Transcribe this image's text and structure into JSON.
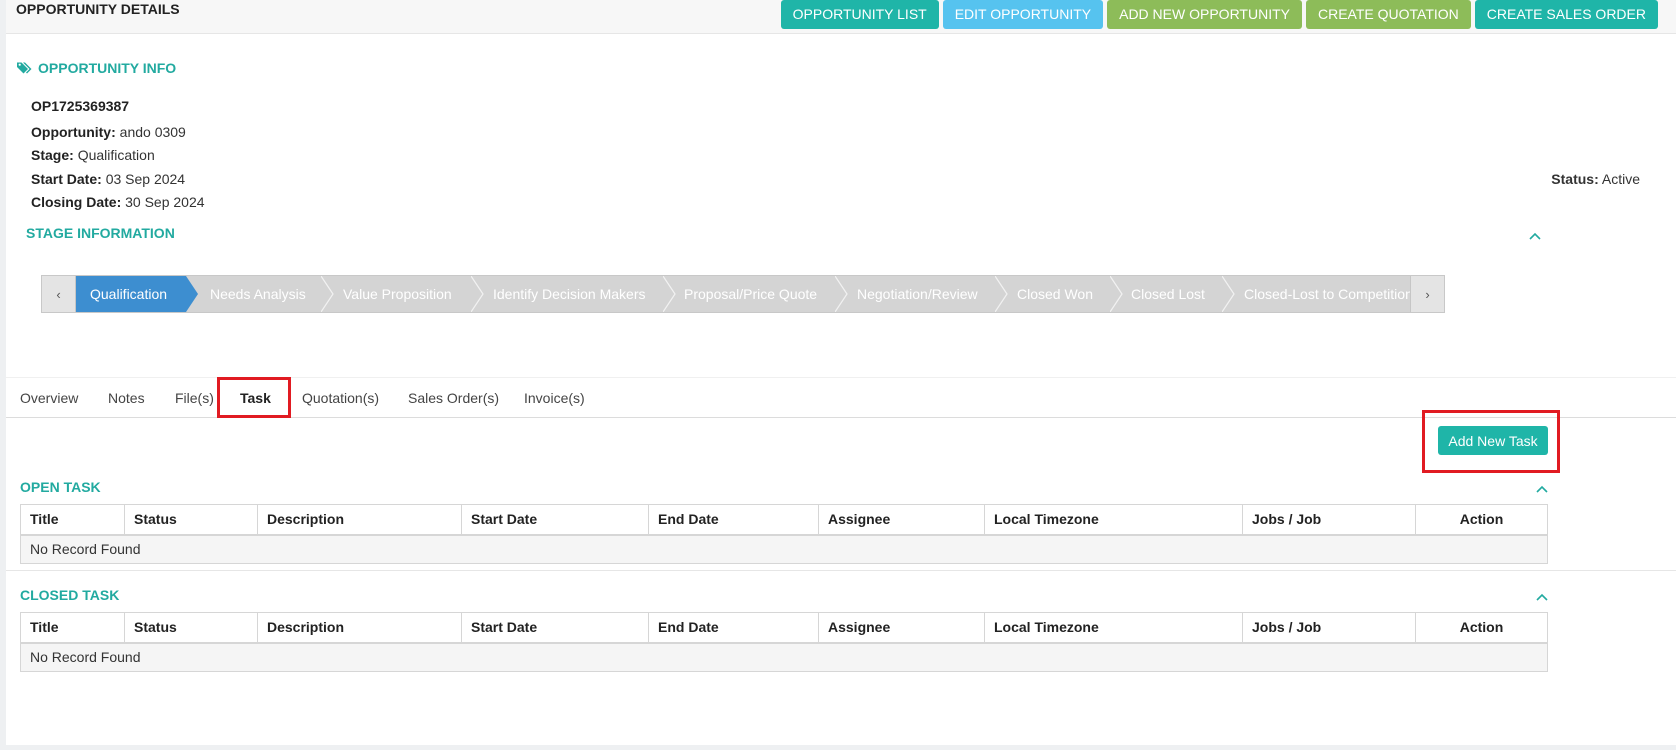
{
  "header": {
    "title": "OPPORTUNITY DETAILS",
    "actions": [
      {
        "label": "OPPORTUNITY LIST",
        "color": "#1fb5a8"
      },
      {
        "label": "EDIT OPPORTUNITY",
        "color": "#56c3ef"
      },
      {
        "label": "ADD NEW OPPORTUNITY",
        "color": "#8dbc59"
      },
      {
        "label": "CREATE QUOTATION",
        "color": "#8dbc59"
      },
      {
        "label": "CREATE SALES ORDER",
        "color": "#1fb5a8"
      }
    ]
  },
  "info": {
    "section_title": "OPPORTUNITY INFO",
    "icon": "tags-icon",
    "code": "OP1725369387",
    "opportunity_label": "Opportunity:",
    "opportunity_value": "ando 0309",
    "stage_label": "Stage:",
    "stage_value": "Qualification",
    "start_label": "Start Date:",
    "start_value": "03 Sep 2024",
    "closing_label": "Closing Date:",
    "closing_value": "30 Sep 2024",
    "status_label": "Status:",
    "status_value": "Active"
  },
  "stage_info": {
    "title": "STAGE INFORMATION",
    "prev_icon": "chevron-left-icon",
    "next_icon": "chevron-right-icon",
    "stages": [
      "Qualification",
      "Needs Analysis",
      "Value Proposition",
      "Identify Decision Makers",
      "Proposal/Price Quote",
      "Negotiation/Review",
      "Closed Won",
      "Closed Lost",
      "Closed-Lost to Competition"
    ],
    "active_stage": "Qualification",
    "active_color": "#3d8ed0"
  },
  "tabs": {
    "items": [
      "Overview",
      "Notes",
      "File(s)",
      "Task",
      "Quotation(s)",
      "Sales Order(s)",
      "Invoice(s)"
    ],
    "active": "Task"
  },
  "task": {
    "add_label": "Add New Task",
    "columns": [
      "Title",
      "Status",
      "Description",
      "Start Date",
      "End Date",
      "Assignee",
      "Local Timezone",
      "Jobs / Job",
      "Action"
    ],
    "open": {
      "title": "OPEN TASK",
      "empty": "No Record Found"
    },
    "closed": {
      "title": "CLOSED TASK",
      "empty": "No Record Found"
    }
  },
  "colors": {
    "accent": "#22aaa0",
    "highlight": "#e11b22"
  }
}
